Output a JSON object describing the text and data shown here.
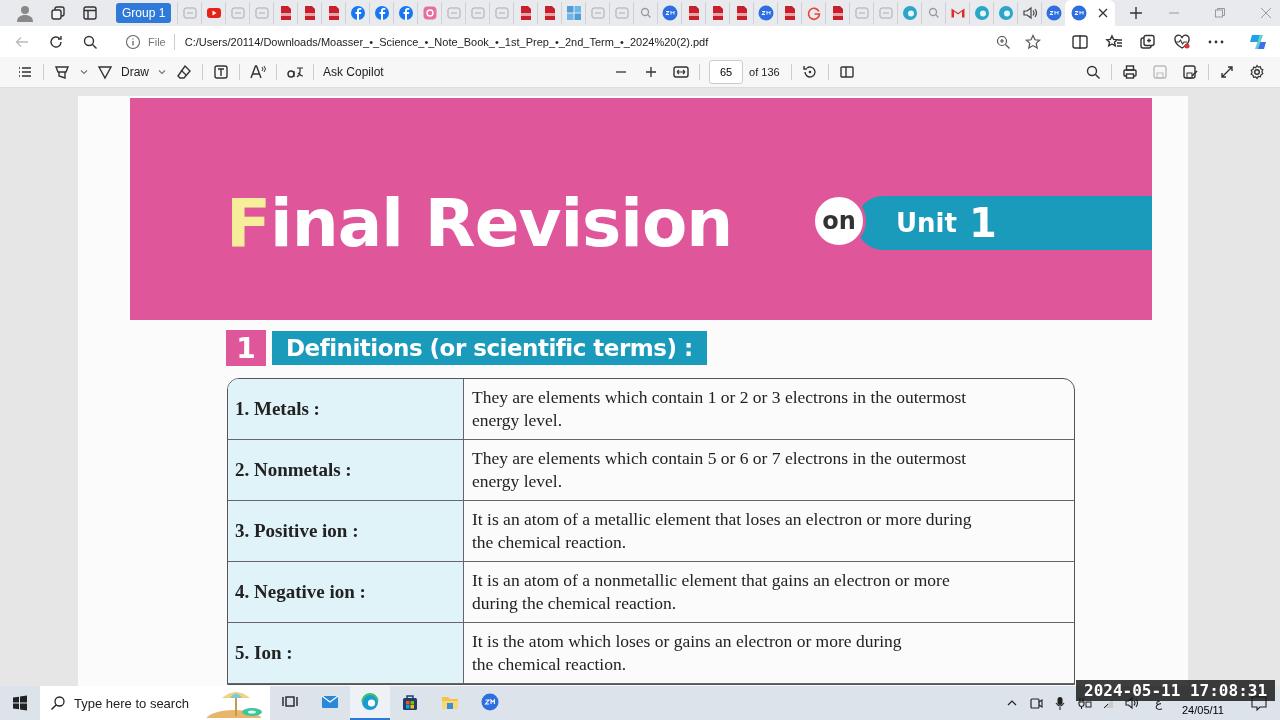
{
  "browser": {
    "group_label": "Group 1",
    "tabs": [
      {
        "kind": "blank",
        "selected": false
      },
      {
        "kind": "youtube",
        "selected": false
      },
      {
        "kind": "blank",
        "selected": false
      },
      {
        "kind": "blank",
        "selected": false
      },
      {
        "kind": "pdf",
        "selected": false
      },
      {
        "kind": "pdf",
        "selected": false
      },
      {
        "kind": "pdf",
        "selected": false
      },
      {
        "kind": "facebook",
        "selected": false
      },
      {
        "kind": "facebook",
        "selected": false
      },
      {
        "kind": "facebook",
        "selected": false
      },
      {
        "kind": "instagram",
        "selected": false
      },
      {
        "kind": "blank",
        "selected": false
      },
      {
        "kind": "blank",
        "selected": false
      },
      {
        "kind": "blank",
        "selected": false
      },
      {
        "kind": "pdf",
        "selected": false
      },
      {
        "kind": "pdf",
        "selected": false
      },
      {
        "kind": "windows",
        "selected": false
      },
      {
        "kind": "blank",
        "selected": false
      },
      {
        "kind": "blank",
        "selected": false
      },
      {
        "kind": "search",
        "selected": false
      },
      {
        "kind": "zoom",
        "selected": false
      },
      {
        "kind": "pdf",
        "selected": false
      },
      {
        "kind": "pdf",
        "selected": false
      },
      {
        "kind": "pdf",
        "selected": false
      },
      {
        "kind": "zoom",
        "selected": false
      },
      {
        "kind": "pdf",
        "selected": false
      },
      {
        "kind": "google",
        "selected": false
      },
      {
        "kind": "pdf",
        "selected": false
      },
      {
        "kind": "blank",
        "selected": false
      },
      {
        "kind": "blank",
        "selected": false
      },
      {
        "kind": "edge",
        "selected": false
      },
      {
        "kind": "search",
        "selected": false
      },
      {
        "kind": "gmail",
        "selected": false
      },
      {
        "kind": "edge",
        "selected": false
      },
      {
        "kind": "edge",
        "selected": false
      },
      {
        "kind": "speaker",
        "selected": false
      },
      {
        "kind": "zoom",
        "selected": false
      },
      {
        "kind": "zoom",
        "selected": true
      }
    ],
    "address": {
      "scheme_label": "File",
      "url": "C:/Users/20114/Downloads/Moasser_•_Science_•_Note_Book_•_1st_Prep_•_2nd_Term_•_2024%20(2).pdf"
    }
  },
  "pdf_toolbar": {
    "draw_label": "Draw",
    "copilot_label": "Ask Copilot",
    "page_number": "65",
    "page_total": "of 136"
  },
  "document": {
    "banner_title": "Final Revision",
    "banner_on": "on",
    "banner_unit": "Unit",
    "banner_unit_number": "1",
    "section_number": "1",
    "section_title": "Definitions (or scientific terms) :",
    "rows": [
      {
        "term": "1. Metals :",
        "definition": "They are elements which contain 1 or 2 or 3 electrons in the outermost\nenergy level."
      },
      {
        "term": "2. Nonmetals :",
        "definition": "They are elements which contain 5 or 6 or 7 electrons in the outermost\nenergy level."
      },
      {
        "term": "3. Positive ion :",
        "definition": "It is an atom of a metallic element that loses an electron or more during\nthe chemical reaction."
      },
      {
        "term": "4. Negative ion :",
        "definition": "It is an atom of a nonmetallic element that gains an electron or more\nduring the chemical reaction."
      },
      {
        "term": "5. Ion :",
        "definition": "It is the atom which loses or gains an electron or more during\nthe chemical reaction."
      }
    ]
  },
  "taskbar": {
    "search_placeholder": "Type here to search",
    "apps": [
      {
        "kind": "taskview",
        "selected": false
      },
      {
        "kind": "mail",
        "selected": false
      },
      {
        "kind": "edge",
        "selected": true
      },
      {
        "kind": "store",
        "selected": false
      },
      {
        "kind": "explorer",
        "selected": false
      },
      {
        "kind": "zoom",
        "selected": false
      }
    ],
    "language": "ع",
    "date": "24/05/11"
  },
  "recording_timestamp": "2024-05-11 17:08:31"
}
